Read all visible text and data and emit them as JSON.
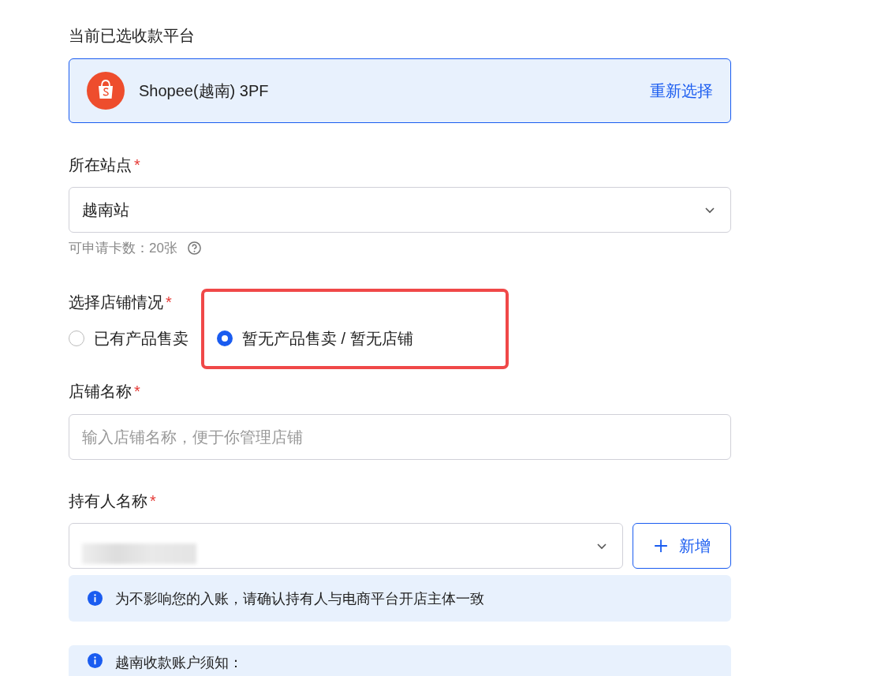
{
  "platform": {
    "label": "当前已选收款平台",
    "name": "Shopee(越南) 3PF",
    "action": "重新选择"
  },
  "site": {
    "label": "所在站点",
    "required_mark": "*",
    "value": "越南站",
    "hint": "可申请卡数：20张"
  },
  "store_status": {
    "label": "选择店铺情况",
    "required_mark": "*",
    "options": [
      {
        "label": "已有产品售卖",
        "selected": false,
        "highlighted": false
      },
      {
        "label": "暂无产品售卖 / 暂无店铺",
        "selected": true,
        "highlighted": true
      }
    ]
  },
  "store_name": {
    "label": "店铺名称",
    "required_mark": "*",
    "placeholder": "输入店铺名称，便于你管理店铺"
  },
  "owner": {
    "label": "持有人名称",
    "required_mark": "*",
    "add_button": "新增",
    "info": "为不影响您的入账，请确认持有人与电商平台开店主体一致"
  },
  "notice": {
    "title": "越南收款账户须知："
  }
}
